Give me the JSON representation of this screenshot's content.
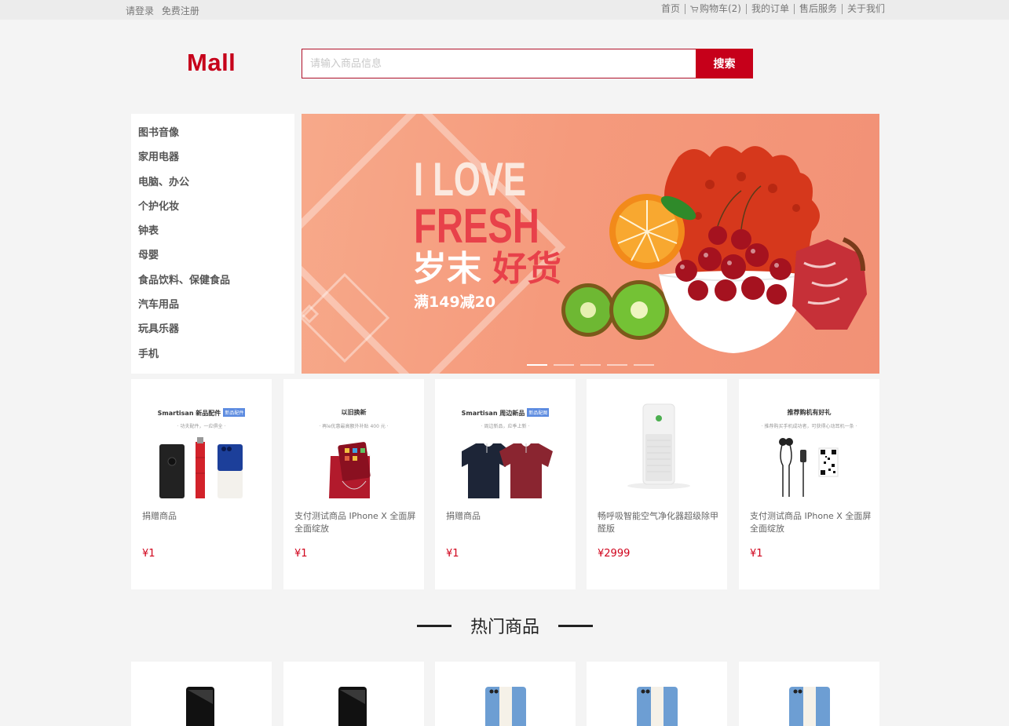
{
  "topbar": {
    "login": "请登录",
    "register": "免费注册",
    "links": [
      "首页",
      "购物车(2)",
      "我的订单",
      "售后服务",
      "关于我们"
    ]
  },
  "header": {
    "logo": "Mall",
    "search_placeholder": "请输入商品信息",
    "search_button": "搜索"
  },
  "categories": [
    "图书音像",
    "家用电器",
    "电脑、办公",
    "个护化妆",
    "钟表",
    "母婴",
    "食品饮料、保健食品",
    "汽车用品",
    "玩具乐器",
    "手机"
  ],
  "banner": {
    "line1": "I LOVE",
    "line2": "FRESH",
    "line3a": "岁末",
    "line3b": "好货",
    "line4": "满149减20",
    "slide_count": 5,
    "active_slide": 1
  },
  "products": [
    {
      "promo_title": "Smartisan 新品配件",
      "promo_badge": "新品配件",
      "promo_sub": "· 功夫配件，一应俱全 ·",
      "name": "捐赠商品",
      "price": "¥1",
      "pic": "accessories"
    },
    {
      "promo_title": "以旧换新",
      "promo_badge": "",
      "promo_sub": "· 再le优惠最高额外补贴 400 元 ·",
      "name": "支付测试商品 IPhone X 全面屏 全面绽放",
      "price": "¥1",
      "pic": "trade-in-bag"
    },
    {
      "promo_title": "Smartisan 周边新品",
      "promo_badge": "新品配图",
      "promo_sub": "· 周边新品，应季上新 ·",
      "name": "捐赠商品",
      "price": "¥1",
      "pic": "polo-shirts"
    },
    {
      "promo_title": "",
      "promo_badge": "",
      "promo_sub": "",
      "name": "畅呼吸智能空气净化器超级除甲醛版",
      "price": "¥2999",
      "pic": "air-purifier"
    },
    {
      "promo_title": "推荐购机有好礼",
      "promo_badge": "",
      "promo_sub": "· 推荐购买手机成功者，可获得心动耳机一条 ·",
      "name": "支付测试商品 IPhone X 全面屏 全面绽放",
      "price": "¥1",
      "pic": "earphones-qr"
    }
  ],
  "hot_section": {
    "title": "热门商品",
    "items": [
      "black-phone",
      "black-phone",
      "blue-phone",
      "blue-phone",
      "blue-phone"
    ]
  },
  "colors": {
    "brand_red": "#c6001a",
    "price_red": "#d0021b",
    "page_bg": "#f4f4f4"
  }
}
